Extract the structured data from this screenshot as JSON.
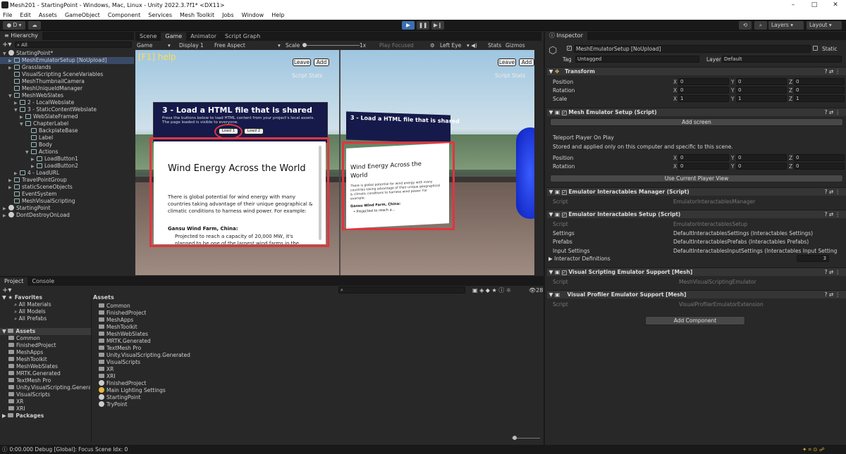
{
  "window": {
    "title": "Mesh201 - StartingPoint - Windows, Mac, Linux - Unity 2022.3.7f1* <DX11>",
    "minimize": "–",
    "maximize": "□",
    "close": "✕"
  },
  "menu": [
    "File",
    "Edit",
    "Assets",
    "GameObject",
    "Component",
    "Services",
    "Mesh Toolkit",
    "Jobs",
    "Window",
    "Help"
  ],
  "toolbar": {
    "account": "D",
    "layers": "Layers",
    "layout": "Layout"
  },
  "hierarchy": {
    "tab": "Hierarchy",
    "search_placeholder": "All",
    "items": [
      {
        "label": "StartingPoint*",
        "depth": 0,
        "tri": "▼",
        "icon": "unity"
      },
      {
        "label": "MeshEmulatorSetup [NoUpload]",
        "depth": 1,
        "tri": "▶",
        "icon": "go",
        "sel": true
      },
      {
        "label": "Grasslands",
        "depth": 1,
        "tri": "▶",
        "icon": "go"
      },
      {
        "label": "VisualScripting SceneVariables",
        "depth": 1,
        "tri": "",
        "icon": "go"
      },
      {
        "label": "MeshThumbnailCamera",
        "depth": 1,
        "tri": "",
        "icon": "go"
      },
      {
        "label": "MeshUniqueIdManager",
        "depth": 1,
        "tri": "",
        "icon": "go"
      },
      {
        "label": "MeshWebSlates",
        "depth": 1,
        "tri": "▼",
        "icon": "go"
      },
      {
        "label": "2 - LocalWebslate",
        "depth": 2,
        "tri": "▶",
        "icon": "go"
      },
      {
        "label": "3 - StaticContentWebslate",
        "depth": 2,
        "tri": "▼",
        "icon": "go"
      },
      {
        "label": "WebSlateFramed",
        "depth": 3,
        "tri": "▶",
        "icon": "go"
      },
      {
        "label": "ChapterLabel",
        "depth": 3,
        "tri": "▼",
        "icon": "go"
      },
      {
        "label": "BackplateBase",
        "depth": 4,
        "tri": "",
        "icon": "go"
      },
      {
        "label": "Label",
        "depth": 4,
        "tri": "",
        "icon": "go"
      },
      {
        "label": "Body",
        "depth": 4,
        "tri": "",
        "icon": "go"
      },
      {
        "label": "Actions",
        "depth": 4,
        "tri": "▼",
        "icon": "go"
      },
      {
        "label": "LoadButton1",
        "depth": 5,
        "tri": "▶",
        "icon": "go"
      },
      {
        "label": "LoadButton2",
        "depth": 5,
        "tri": "▶",
        "icon": "go"
      },
      {
        "label": "4 - LoadURL",
        "depth": 2,
        "tri": "▶",
        "icon": "go"
      },
      {
        "label": "TravelPointGroup",
        "depth": 1,
        "tri": "▶",
        "icon": "go"
      },
      {
        "label": "staticSceneObjects",
        "depth": 1,
        "tri": "▶",
        "icon": "go"
      },
      {
        "label": "EventSystem",
        "depth": 1,
        "tri": "",
        "icon": "go"
      },
      {
        "label": "MeshVisualScripting",
        "depth": 1,
        "tri": "",
        "icon": "go"
      },
      {
        "label": "StartingPoint",
        "depth": 0,
        "tri": "▶",
        "icon": "unity"
      },
      {
        "label": "DontDestroyOnLoad",
        "depth": 0,
        "tri": "▶",
        "icon": "unity"
      }
    ]
  },
  "game": {
    "tabs": [
      "Scene",
      "Game",
      "Animator",
      "Script Graph"
    ],
    "bar": {
      "mode": "Game",
      "display": "Display 1",
      "aspect": "Free Aspect",
      "scale_label": "Scale",
      "scale_value": "1x",
      "play_focused": "Play Focused",
      "eye": "Left Eye",
      "stats": "Stats",
      "gizmos": "Gizmos"
    },
    "help": "[F1] help",
    "leave": "Leave",
    "add": "Add",
    "script_stats": "Script Stats",
    "panel_title": "3 - Load a HTML file that is shared",
    "panel_desc": "Press the buttons below to load HTML content from your project's local assets. The page loaded is visible to everyone.",
    "load1": "Load 1",
    "load2": "Load 2",
    "doc_title": "Wind Energy Across the World",
    "doc_body": "There is global potential for wind energy with many countries taking advantage of their unique geographical & climatic conditions to harness wind power. For example:",
    "doc_sub": "Gansu Wind Farm, China:",
    "doc_bullet": "Projected to reach a capacity of 20,000 MW, it's planned to be one of the largest wind farms in the",
    "right_title": "3 - Load a HTML file that is shared",
    "right_doc_title": "Wind Energy Across the World",
    "right_doc_body": "There is global potential for wind energy with many countries taking advantage of their unique geographical & climatic conditions to harness wind power. For example:",
    "right_doc_sub": "Gansu Wind Farm, China:",
    "right_doc_bullet": "• Projected to reach a..."
  },
  "project": {
    "tabs": [
      "Project",
      "Console"
    ],
    "favorites": {
      "label": "Favorites",
      "items": [
        "All Materials",
        "All Models",
        "All Prefabs"
      ]
    },
    "tree": {
      "label": "Assets",
      "items": [
        "Common",
        "FinishedProject",
        "MeshApps",
        "MeshToolkit",
        "MeshWebSlates",
        "MRTK.Generated",
        "TextMesh Pro",
        "Unity.VisualScripting.Generated",
        "VisualScripts",
        "XR",
        "XRI"
      ],
      "packages": "Packages"
    },
    "assets_header": "Assets",
    "assets": [
      {
        "label": "Common",
        "icon": "folder"
      },
      {
        "label": "FinishedProject",
        "icon": "folder"
      },
      {
        "label": "MeshApps",
        "icon": "folder"
      },
      {
        "label": "MeshToolkit",
        "icon": "folder"
      },
      {
        "label": "MeshWebSlates",
        "icon": "folder"
      },
      {
        "label": "MRTK.Generated",
        "icon": "folder"
      },
      {
        "label": "TextMesh Pro",
        "icon": "folder"
      },
      {
        "label": "Unity.VisualScripting.Generated",
        "icon": "folder"
      },
      {
        "label": "VisualScripts",
        "icon": "folder"
      },
      {
        "label": "XR",
        "icon": "folder"
      },
      {
        "label": "XRI",
        "icon": "folder"
      },
      {
        "label": "FinishedProject",
        "icon": "unity"
      },
      {
        "label": "Main Lighting Settings",
        "icon": "light"
      },
      {
        "label": "StartingPoint",
        "icon": "unity"
      },
      {
        "label": "TryPoint",
        "icon": "unity"
      }
    ],
    "count": "28"
  },
  "status": {
    "text": "0:00.000 Debug [Global]: Focus Scene Idx: 0"
  },
  "inspector": {
    "tab": "Inspector",
    "object_name": "MeshEmulatorSetup [NoUpload]",
    "static": "Static",
    "tag_label": "Tag",
    "tag": "Untagged",
    "layer_label": "Layer",
    "layer": "Default",
    "transform": {
      "title": "Transform",
      "rows": [
        {
          "label": "Position",
          "x": "0",
          "y": "0",
          "z": "0"
        },
        {
          "label": "Rotation",
          "x": "0",
          "y": "0",
          "z": "0"
        },
        {
          "label": "Scale",
          "x": "1",
          "y": "1",
          "z": "1"
        }
      ]
    },
    "mesh_emulator": {
      "title": "Mesh Emulator Setup (Script)",
      "add_screen": "Add screen",
      "teleport": "Teleport Player On Play",
      "teleport_desc": "Stored and applied only on this computer and specific to this scene.",
      "rows": [
        {
          "label": "Position",
          "x": "0",
          "y": "0",
          "z": "0"
        },
        {
          "label": "Rotation",
          "x": "0",
          "y": "0",
          "z": "0"
        }
      ],
      "use_view": "Use Current Player View"
    },
    "manager": {
      "title": "Emulator Interactables Manager (Script)",
      "script_label": "Script",
      "script": "EmulatorInteractablesManager"
    },
    "setup": {
      "title": "Emulator Interactables Setup (Script)",
      "fields": [
        {
          "label": "Script",
          "value": "EmulatorInteractablesSetup"
        },
        {
          "label": "Settings",
          "value": "DefaultInteractablesSettings (Interactables Settings)"
        },
        {
          "label": "Prefabs",
          "value": "DefaultInteractablesPrefabs (Interactables Prefabs)"
        },
        {
          "label": "Input Settings",
          "value": "DefaultInteractablesInputSettings (Interactables Input Settings)"
        }
      ],
      "defs_label": "Interactor Definitions",
      "defs_count": "3"
    },
    "vs": {
      "title": "Visual Scripting Emulator Support [Mesh]",
      "script_label": "Script",
      "script": "MeshVisualScriptingEmulator"
    },
    "vp": {
      "title": "Visual Profiler Emulator Support [Mesh]",
      "script_label": "Script",
      "script": "VisualProfilerEmulatorExtension"
    },
    "add_component": "Add Component"
  },
  "colors": {
    "accent": "#3a4a66",
    "highlight": "#e0353f",
    "panel_navy": "#151a4a"
  }
}
